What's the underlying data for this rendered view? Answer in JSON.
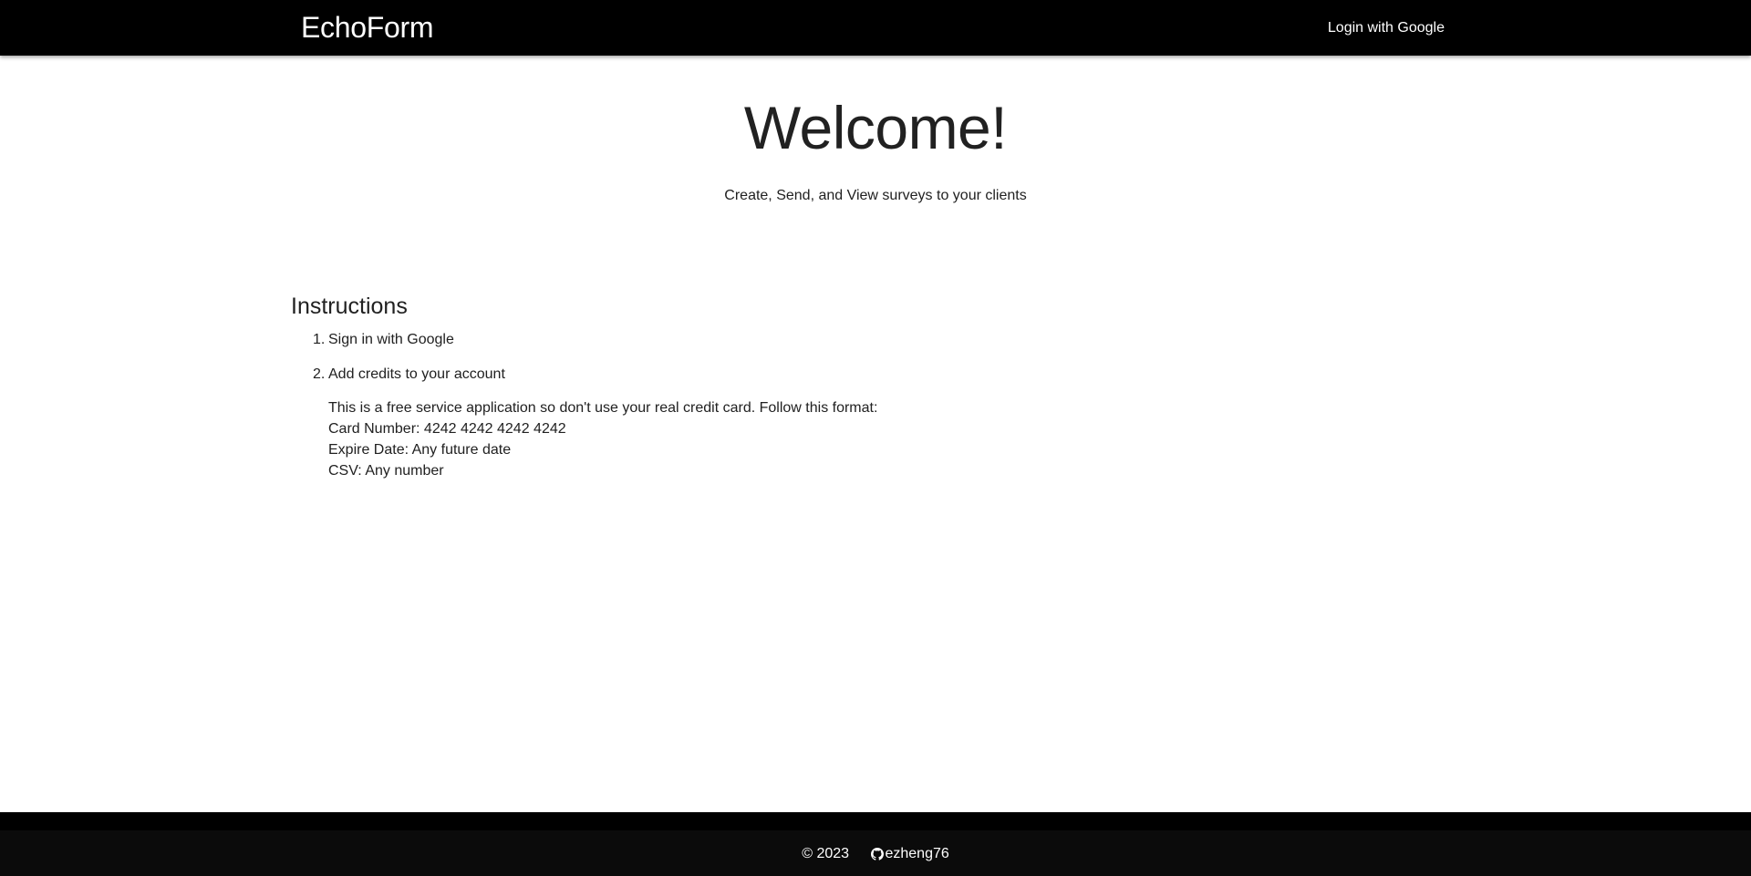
{
  "navbar": {
    "brand": "EchoForm",
    "login_label": "Login with Google"
  },
  "hero": {
    "title": "Welcome!",
    "subtitle": "Create, Send, and View surveys to your clients"
  },
  "instructions": {
    "title": "Instructions",
    "steps": [
      {
        "number": "1.",
        "label": "Sign in with Google"
      },
      {
        "number": "2.",
        "label": "Add credits to your account"
      }
    ],
    "note_lines": [
      "This is a free service application so don't use your real credit card. Follow this format:",
      "Card Number: 4242 4242 4242 4242",
      "Expire Date: Any future date",
      "CSV: Any number"
    ]
  },
  "footer": {
    "copyright": "© 2023",
    "github_user": "ezheng76",
    "github_icon": "github-icon"
  },
  "colors": {
    "navbar_bg": "#000000",
    "footer_bg": "#0b0b0b",
    "text": "#212121"
  }
}
